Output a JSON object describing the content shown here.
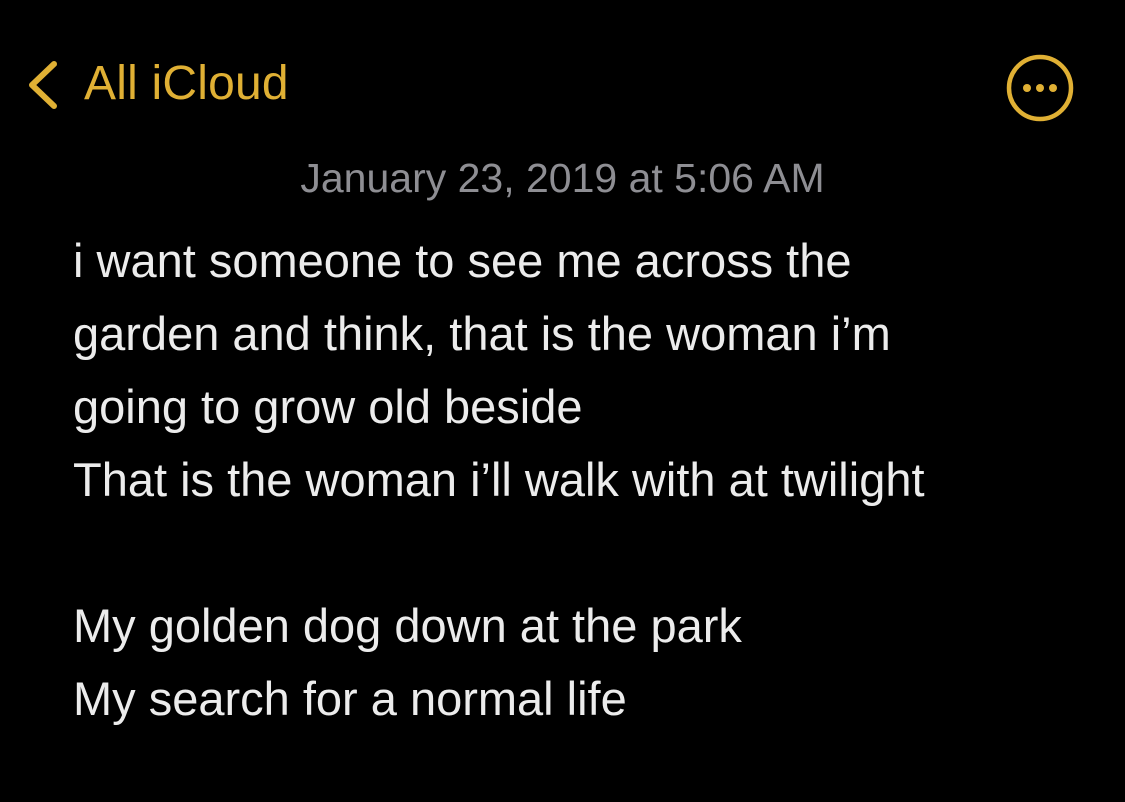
{
  "nav": {
    "back_label": "All iCloud",
    "back_icon": "chevron-left-icon",
    "more_icon": "ellipsis-circle-icon"
  },
  "note": {
    "date": "January 23, 2019 at 5:06 AM",
    "lines": [
      "i want someone to see me across the",
      "garden and think, that is the woman i’m",
      "going to grow old beside",
      "That is the woman i’ll walk with at twilight",
      "",
      "My golden dog down at the park",
      "My search for a normal life"
    ]
  },
  "colors": {
    "background": "#000000",
    "accent": "#E0B034",
    "text": "#ECECEC",
    "secondary_text": "#8E8E93"
  }
}
